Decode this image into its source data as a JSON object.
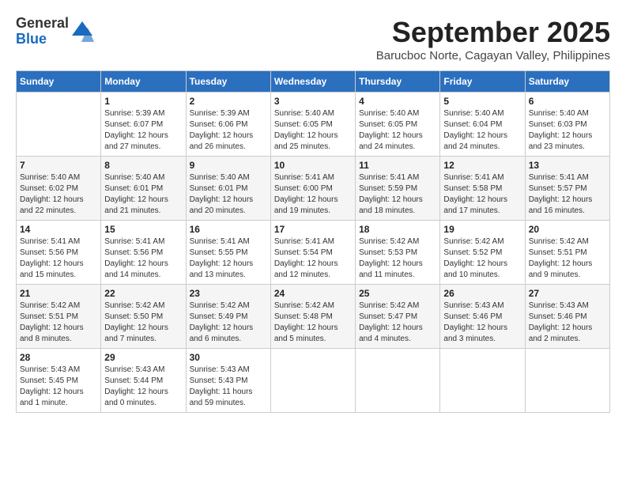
{
  "logo": {
    "general": "General",
    "blue": "Blue"
  },
  "title": "September 2025",
  "subtitle": "Barucboc Norte, Cagayan Valley, Philippines",
  "days_of_week": [
    "Sunday",
    "Monday",
    "Tuesday",
    "Wednesday",
    "Thursday",
    "Friday",
    "Saturday"
  ],
  "weeks": [
    [
      {
        "day": "",
        "info": ""
      },
      {
        "day": "1",
        "info": "Sunrise: 5:39 AM\nSunset: 6:07 PM\nDaylight: 12 hours\nand 27 minutes."
      },
      {
        "day": "2",
        "info": "Sunrise: 5:39 AM\nSunset: 6:06 PM\nDaylight: 12 hours\nand 26 minutes."
      },
      {
        "day": "3",
        "info": "Sunrise: 5:40 AM\nSunset: 6:05 PM\nDaylight: 12 hours\nand 25 minutes."
      },
      {
        "day": "4",
        "info": "Sunrise: 5:40 AM\nSunset: 6:05 PM\nDaylight: 12 hours\nand 24 minutes."
      },
      {
        "day": "5",
        "info": "Sunrise: 5:40 AM\nSunset: 6:04 PM\nDaylight: 12 hours\nand 24 minutes."
      },
      {
        "day": "6",
        "info": "Sunrise: 5:40 AM\nSunset: 6:03 PM\nDaylight: 12 hours\nand 23 minutes."
      }
    ],
    [
      {
        "day": "7",
        "info": "Sunrise: 5:40 AM\nSunset: 6:02 PM\nDaylight: 12 hours\nand 22 minutes."
      },
      {
        "day": "8",
        "info": "Sunrise: 5:40 AM\nSunset: 6:01 PM\nDaylight: 12 hours\nand 21 minutes."
      },
      {
        "day": "9",
        "info": "Sunrise: 5:40 AM\nSunset: 6:01 PM\nDaylight: 12 hours\nand 20 minutes."
      },
      {
        "day": "10",
        "info": "Sunrise: 5:41 AM\nSunset: 6:00 PM\nDaylight: 12 hours\nand 19 minutes."
      },
      {
        "day": "11",
        "info": "Sunrise: 5:41 AM\nSunset: 5:59 PM\nDaylight: 12 hours\nand 18 minutes."
      },
      {
        "day": "12",
        "info": "Sunrise: 5:41 AM\nSunset: 5:58 PM\nDaylight: 12 hours\nand 17 minutes."
      },
      {
        "day": "13",
        "info": "Sunrise: 5:41 AM\nSunset: 5:57 PM\nDaylight: 12 hours\nand 16 minutes."
      }
    ],
    [
      {
        "day": "14",
        "info": "Sunrise: 5:41 AM\nSunset: 5:56 PM\nDaylight: 12 hours\nand 15 minutes."
      },
      {
        "day": "15",
        "info": "Sunrise: 5:41 AM\nSunset: 5:56 PM\nDaylight: 12 hours\nand 14 minutes."
      },
      {
        "day": "16",
        "info": "Sunrise: 5:41 AM\nSunset: 5:55 PM\nDaylight: 12 hours\nand 13 minutes."
      },
      {
        "day": "17",
        "info": "Sunrise: 5:41 AM\nSunset: 5:54 PM\nDaylight: 12 hours\nand 12 minutes."
      },
      {
        "day": "18",
        "info": "Sunrise: 5:42 AM\nSunset: 5:53 PM\nDaylight: 12 hours\nand 11 minutes."
      },
      {
        "day": "19",
        "info": "Sunrise: 5:42 AM\nSunset: 5:52 PM\nDaylight: 12 hours\nand 10 minutes."
      },
      {
        "day": "20",
        "info": "Sunrise: 5:42 AM\nSunset: 5:51 PM\nDaylight: 12 hours\nand 9 minutes."
      }
    ],
    [
      {
        "day": "21",
        "info": "Sunrise: 5:42 AM\nSunset: 5:51 PM\nDaylight: 12 hours\nand 8 minutes."
      },
      {
        "day": "22",
        "info": "Sunrise: 5:42 AM\nSunset: 5:50 PM\nDaylight: 12 hours\nand 7 minutes."
      },
      {
        "day": "23",
        "info": "Sunrise: 5:42 AM\nSunset: 5:49 PM\nDaylight: 12 hours\nand 6 minutes."
      },
      {
        "day": "24",
        "info": "Sunrise: 5:42 AM\nSunset: 5:48 PM\nDaylight: 12 hours\nand 5 minutes."
      },
      {
        "day": "25",
        "info": "Sunrise: 5:42 AM\nSunset: 5:47 PM\nDaylight: 12 hours\nand 4 minutes."
      },
      {
        "day": "26",
        "info": "Sunrise: 5:43 AM\nSunset: 5:46 PM\nDaylight: 12 hours\nand 3 minutes."
      },
      {
        "day": "27",
        "info": "Sunrise: 5:43 AM\nSunset: 5:46 PM\nDaylight: 12 hours\nand 2 minutes."
      }
    ],
    [
      {
        "day": "28",
        "info": "Sunrise: 5:43 AM\nSunset: 5:45 PM\nDaylight: 12 hours\nand 1 minute."
      },
      {
        "day": "29",
        "info": "Sunrise: 5:43 AM\nSunset: 5:44 PM\nDaylight: 12 hours\nand 0 minutes."
      },
      {
        "day": "30",
        "info": "Sunrise: 5:43 AM\nSunset: 5:43 PM\nDaylight: 11 hours\nand 59 minutes."
      },
      {
        "day": "",
        "info": ""
      },
      {
        "day": "",
        "info": ""
      },
      {
        "day": "",
        "info": ""
      },
      {
        "day": "",
        "info": ""
      }
    ]
  ]
}
